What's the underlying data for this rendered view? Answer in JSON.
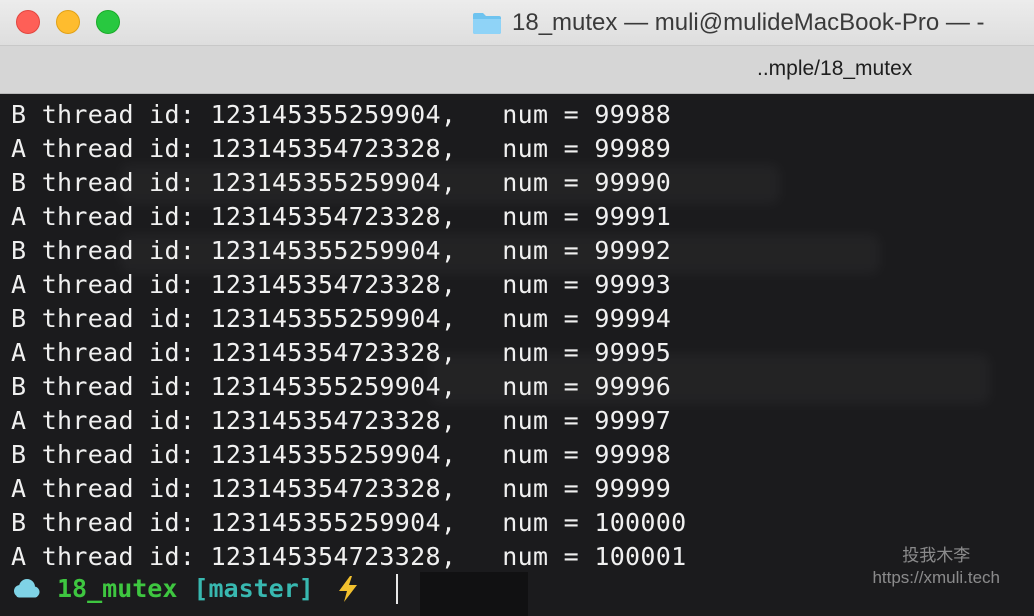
{
  "titlebar": {
    "title": "18_mutex — muli@mulideMacBook-Pro — -",
    "folder_icon": "folder-icon"
  },
  "tab": {
    "label": "..mple/18_mutex"
  },
  "terminal": {
    "lines": [
      "B thread id: 123145355259904,   num = 99988",
      "A thread id: 123145354723328,   num = 99989",
      "B thread id: 123145355259904,   num = 99990",
      "A thread id: 123145354723328,   num = 99991",
      "B thread id: 123145355259904,   num = 99992",
      "A thread id: 123145354723328,   num = 99993",
      "B thread id: 123145355259904,   num = 99994",
      "A thread id: 123145354723328,   num = 99995",
      "B thread id: 123145355259904,   num = 99996",
      "A thread id: 123145354723328,   num = 99997",
      "B thread id: 123145355259904,   num = 99998",
      "A thread id: 123145354723328,   num = 99999",
      "B thread id: 123145355259904,   num = 100000",
      "A thread id: 123145354723328,   num = 100001"
    ],
    "prompt": {
      "icon": "cloud-icon",
      "directory": "18_mutex",
      "branch": "[master]",
      "status_icon": "lightning-bolt-icon"
    }
  },
  "watermark": {
    "name": "投我木李",
    "url": "https://xmuli.tech"
  },
  "colors": {
    "background": "#1b1b1d",
    "text": "#f0f0f0",
    "directory": "#3ec640",
    "branch": "#38b8b0",
    "bolt": "#f2c12e",
    "cloud": "#7fd3e6"
  }
}
